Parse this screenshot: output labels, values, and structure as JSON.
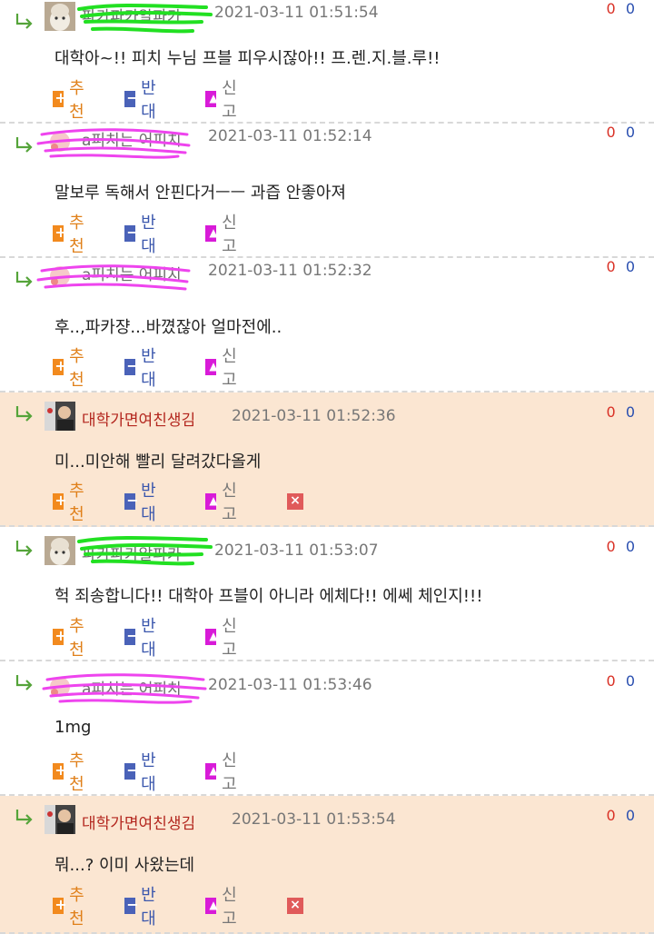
{
  "comments": [
    {
      "author": "파카파카알파카",
      "date": "2021-03-11 01:51:54",
      "text": "대학아~!! 피치 누님 프블 피우시잖아!! 프.렌.지.블.루!!",
      "up": "0",
      "down": "0",
      "recommend": "추천",
      "oppose": "반대",
      "report": "신고"
    },
    {
      "author": "a피치는 어피치",
      "date": "2021-03-11 01:52:14",
      "text": "말보루 독해서 안핀다거ㅡㅡ 과즙 안좋아져",
      "up": "0",
      "down": "0",
      "recommend": "추천",
      "oppose": "반대",
      "report": "신고"
    },
    {
      "author": "a피치는 어피치",
      "date": "2021-03-11 01:52:32",
      "text": "후..,파카쟝...바꼈잖아 얼마전에..",
      "up": "0",
      "down": "0",
      "recommend": "추천",
      "oppose": "반대",
      "report": "신고"
    },
    {
      "author": "대학가면여친생김",
      "date": "2021-03-11 01:52:36",
      "text": "미...미안해 빨리 달려갔다올게",
      "up": "0",
      "down": "0",
      "recommend": "추천",
      "oppose": "반대",
      "report": "신고"
    },
    {
      "author": "파카파카알파카",
      "date": "2021-03-11 01:53:07",
      "text": "헉 죄송합니다!! 대학아 프블이 아니라 에체다!! 에쎄 체인지!!!",
      "up": "0",
      "down": "0",
      "recommend": "추천",
      "oppose": "반대",
      "report": "신고"
    },
    {
      "author": "a피치는 어피치",
      "date": "2021-03-11 01:53:46",
      "text": "1mg",
      "up": "0",
      "down": "0",
      "recommend": "추천",
      "oppose": "반대",
      "report": "신고"
    },
    {
      "author": "대학가면여친생김",
      "date": "2021-03-11 01:53:54",
      "text": "뭐...? 이미 사왔는데",
      "up": "0",
      "down": "0",
      "recommend": "추천",
      "oppose": "반대",
      "report": "신고"
    }
  ],
  "colors": {
    "highlight": "#fbe6d2",
    "recommend": "#f28a1e",
    "oppose": "#4a62b8",
    "report": "#d81bd8",
    "delete": "#e05a5a",
    "scribble_green": "#22e022",
    "scribble_pink": "#ee44ee"
  }
}
